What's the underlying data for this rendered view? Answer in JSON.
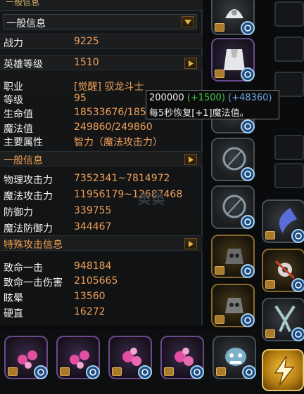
{
  "header": {
    "caption": "一般信息"
  },
  "dropdown": {
    "label": "一般信息",
    "arrow_icon": "chevron-down-icon"
  },
  "stats": [
    {
      "key": "战力",
      "value": "9225"
    },
    {
      "key": "英雄等级",
      "value": "1510"
    },
    {
      "key": "职业",
      "value": "[觉醒] 驭龙斗士"
    },
    {
      "key": "等级",
      "value": "95"
    },
    {
      "key": "生命值",
      "value": "18533676/185"
    },
    {
      "key": "魔法值",
      "value": "249860/249860"
    },
    {
      "key": "主要属性",
      "value": "智力（魔法攻击力）"
    }
  ],
  "section_general": "一般信息",
  "attack": [
    {
      "key": "物理攻击力",
      "value": "7352341~7814972"
    },
    {
      "key": "魔法攻击力",
      "value": "11956179~12687468"
    },
    {
      "key": "防御力",
      "value": "339755"
    },
    {
      "key": "魔法防御力",
      "value": "344467"
    }
  ],
  "section_special": "特殊攻击信息",
  "special": [
    {
      "key": "致命一击",
      "value": "948184"
    },
    {
      "key": "致命一击伤害",
      "value": "2105665"
    },
    {
      "key": "眩晕",
      "value": "13560"
    },
    {
      "key": "硬直",
      "value": "16272"
    }
  ],
  "tooltip": {
    "base": "200000",
    "bonus_green": "(+1500)",
    "bonus_blue": "(+48360)",
    "desc": "每5秒恢复[+1]魔法值。"
  },
  "watermark": "类类",
  "colors": {
    "value": "#f0a05a",
    "section": "#f3a24f",
    "green": "#3ec44a",
    "blue": "#6aa8e6"
  }
}
